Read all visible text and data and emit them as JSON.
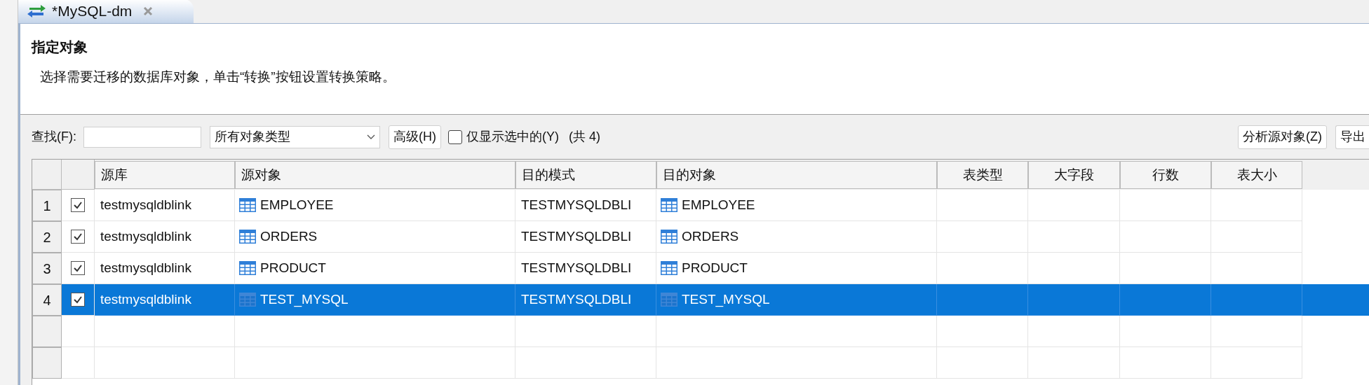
{
  "tab": {
    "title": "*MySQL-dm",
    "selected": true
  },
  "heading": "指定对象",
  "description": "选择需要迁移的数据库对象，单击“转换”按钮设置转换策略。",
  "toolbar": {
    "find_label": "查找(F):",
    "type_select": "所有对象类型",
    "advanced_button": "高级(H)",
    "only_selected": {
      "label": "仅显示选中的(Y)",
      "checked": false
    },
    "count": "(共 4)",
    "analyze_button": "分析源对象(Z)",
    "export_button": "导出"
  },
  "table": {
    "columns": [
      "源库",
      "源对象",
      "目的模式",
      "目的对象",
      "表类型",
      "大字段",
      "行数",
      "表大小"
    ],
    "rows": [
      {
        "index": "1",
        "checked": true,
        "selected": false,
        "source_db": "testmysqldblink",
        "source_object": "EMPLOYEE",
        "target_schema": "TESTMYSQLDBLI",
        "target_object": "EMPLOYEE"
      },
      {
        "index": "2",
        "checked": true,
        "selected": false,
        "source_db": "testmysqldblink",
        "source_object": "ORDERS",
        "target_schema": "TESTMYSQLDBLI",
        "target_object": "ORDERS"
      },
      {
        "index": "3",
        "checked": true,
        "selected": false,
        "source_db": "testmysqldblink",
        "source_object": "PRODUCT",
        "target_schema": "TESTMYSQLDBLI",
        "target_object": "PRODUCT"
      },
      {
        "index": "4",
        "checked": true,
        "selected": true,
        "source_db": "testmysqldblink",
        "source_object": "TEST_MYSQL",
        "target_schema": "TESTMYSQLDBLI",
        "target_object": "TEST_MYSQL"
      }
    ]
  }
}
